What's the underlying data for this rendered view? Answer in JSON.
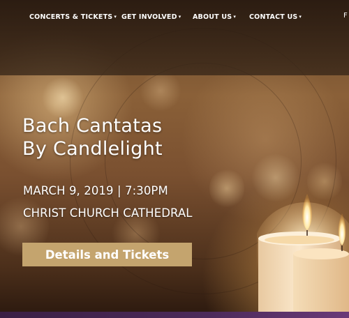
{
  "nav": {
    "items": [
      {
        "label": "CONCERTS & TICKETS"
      },
      {
        "label": "GET INVOLVED"
      },
      {
        "label": "ABOUT US"
      },
      {
        "label": "CONTACT US"
      }
    ],
    "cut_label": "F"
  },
  "hero": {
    "title_line1": "Bach Cantatas",
    "title_line2": "By Candlelight",
    "date_time": "MARCH 9, 2019 | 7:30PM",
    "venue": "CHRIST CHURCH CATHEDRAL",
    "cta_label": "Details and Tickets"
  },
  "colors": {
    "cta": "#c4a46e",
    "nav_band": "#2f1f14",
    "footer_strip": "#4c2a5a"
  },
  "icons": {
    "dropdown": "chevron-down-icon"
  }
}
